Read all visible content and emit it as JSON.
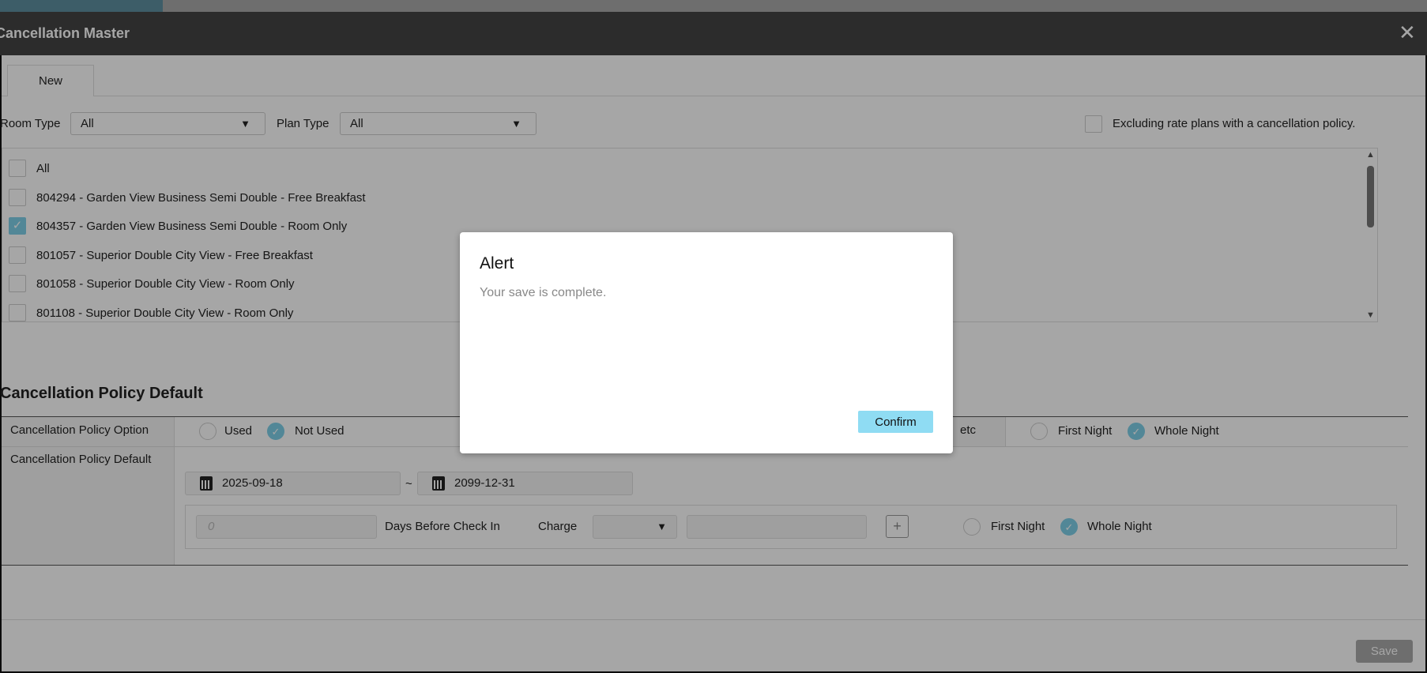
{
  "window": {
    "title": "Cancellation Master",
    "close": "✕"
  },
  "tabs": [
    {
      "label": "New"
    }
  ],
  "filters": {
    "room_type_label": "Room Type",
    "room_type_value": "All",
    "plan_type_label": "Plan Type",
    "plan_type_value": "All",
    "exclude_label": "Excluding rate plans with a cancellation policy.",
    "arrow": "▼"
  },
  "rate_plans": [
    {
      "label": "All",
      "checked": false
    },
    {
      "label": "804294 - Garden View Business Semi Double - Free Breakfast",
      "checked": false
    },
    {
      "label": "804357 - Garden View Business Semi Double - Room Only",
      "checked": true
    },
    {
      "label": "801057 - Superior Double City View - Free Breakfast",
      "checked": false
    },
    {
      "label": "801058 - Superior Double City View - Room Only",
      "checked": false
    },
    {
      "label": "801108 - Superior Double City View - Room Only",
      "checked": false
    }
  ],
  "section": {
    "title": "Cancellation Policy Default",
    "option_label": "Cancellation Policy Option",
    "used": "Used",
    "not_used": "Not Used",
    "etc_label": "etc",
    "first_night": "First Night",
    "whole_night": "Whole Night",
    "default_label": "Cancellation Policy Default",
    "date_from": "2025-09-18",
    "date_sep": "~",
    "date_to": "2099-12-31",
    "days_placeholder": "0",
    "days_label": "Days Before Check In",
    "charge_label": "Charge",
    "add": "+"
  },
  "footer": {
    "save": "Save"
  },
  "alert": {
    "title": "Alert",
    "message": "Your save is complete.",
    "confirm": "Confirm"
  }
}
